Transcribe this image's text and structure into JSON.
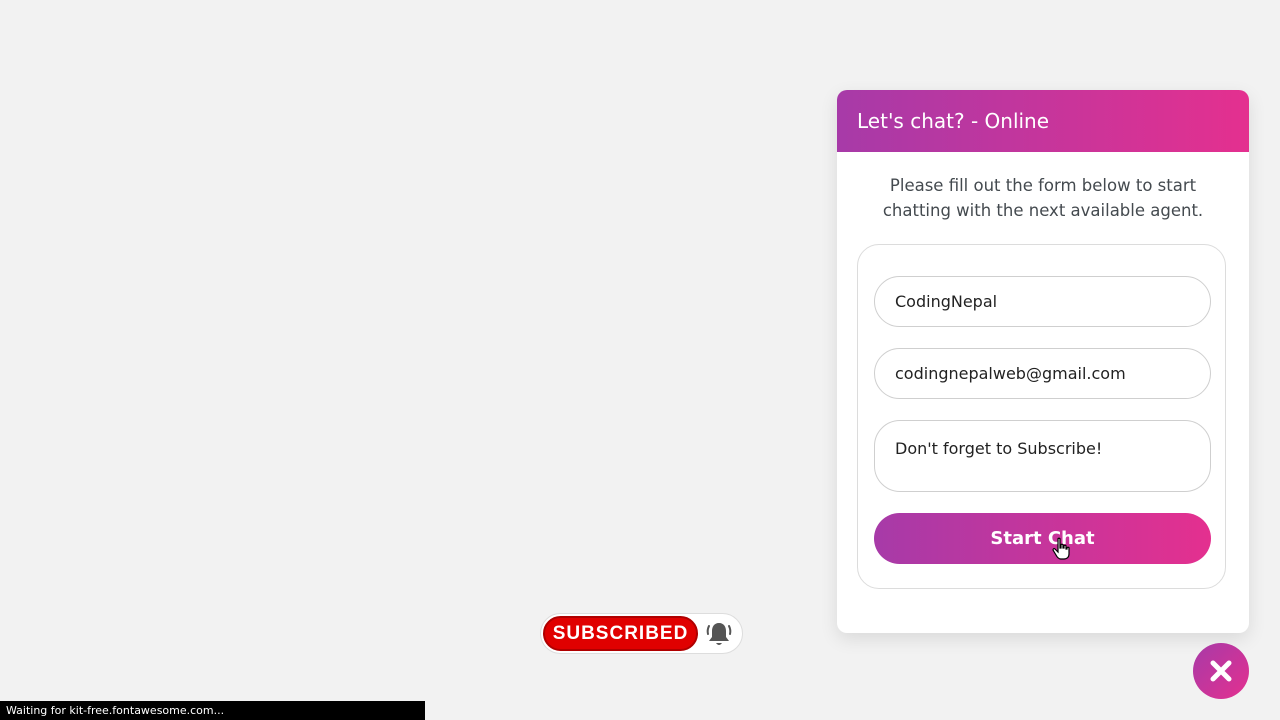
{
  "chat": {
    "header_title": "Let's chat? - Online",
    "description": "Please fill out the form below to start chatting with the next available agent.",
    "form": {
      "name_value": "CodingNepal",
      "email_value": "codingnepalweb@gmail.com",
      "message_value": "Don't forget to Subscribe!",
      "submit_label": "Start Chat"
    }
  },
  "subscribe": {
    "label": "SUBSCRIBED",
    "bell_icon": "bell-icon"
  },
  "close_icon": "close-icon",
  "status_bar": {
    "text": "Waiting for kit-free.fontawesome.com..."
  },
  "colors": {
    "gradient_start": "#a73aa8",
    "gradient_end": "#e4308f",
    "subscribe_red": "#e00000"
  }
}
